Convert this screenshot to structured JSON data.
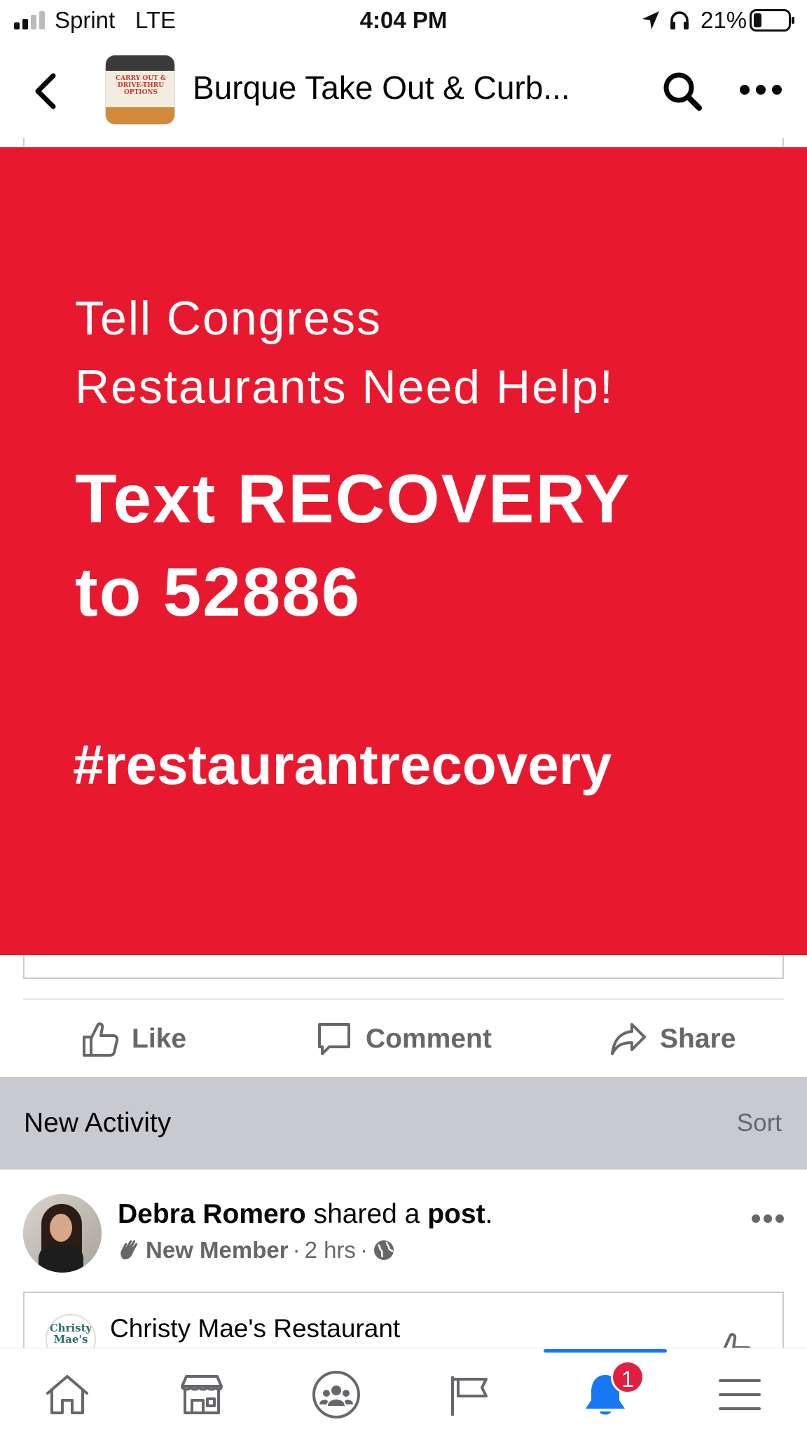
{
  "status_bar": {
    "carrier": "Sprint",
    "network": "LTE",
    "time": "4:04 PM",
    "battery_percent": "21%",
    "icons": [
      "signal-icon",
      "location-icon",
      "headphones-icon",
      "battery-icon"
    ]
  },
  "header": {
    "title": "Burque Take Out & Curb...",
    "group_thumbnail_text": "CARRY OUT & DRIVE-THRU OPTIONS",
    "icons": [
      "back-icon",
      "search-icon",
      "more-icon"
    ]
  },
  "post": {
    "image": {
      "background_color": "#e8192f",
      "line1": "Tell Congress",
      "line2": "Restaurants Need Help!",
      "line3": "Text RECOVERY",
      "line4": "to 52886",
      "line5": "#restaurantrecovery"
    },
    "actions": {
      "like": "Like",
      "comment": "Comment",
      "share": "Share"
    }
  },
  "activity": {
    "label": "New Activity",
    "sort": "Sort"
  },
  "feed_item": {
    "author": "Debra Romero",
    "action_text": "shared a",
    "object": "post",
    "period": ".",
    "badge": "New Member",
    "time": "2 hrs",
    "separator": "·",
    "audience_icon": "globe-icon",
    "shared": {
      "logo_text": "Christy Mae's",
      "name": "Christy Mae's Restaurant"
    }
  },
  "tab_bar": {
    "tabs": [
      "home-icon",
      "marketplace-icon",
      "groups-icon",
      "pages-icon",
      "notifications-icon",
      "menu-icon"
    ],
    "active": "notifications-icon",
    "notification_count": "1",
    "accent_color": "#1877f2",
    "badge_color": "#e41e3f"
  }
}
